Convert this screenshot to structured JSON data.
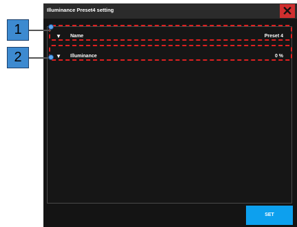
{
  "dialog": {
    "title": "Illuminance Preset4 setting",
    "close_glyph": "✕",
    "rows": [
      {
        "toggle": "▼",
        "label": "Name",
        "value": "Preset 4"
      },
      {
        "toggle": "▼",
        "label": "Illuminance",
        "value": "0 %"
      }
    ],
    "set_label": "SET"
  },
  "callouts": [
    "1",
    "2"
  ],
  "colors": {
    "accent": "#0da0ee",
    "close_bg": "#d02f2f",
    "dialog_bg": "#141414",
    "highlight_dash": "#e02020",
    "callout_bg": "#3d8ad0"
  }
}
